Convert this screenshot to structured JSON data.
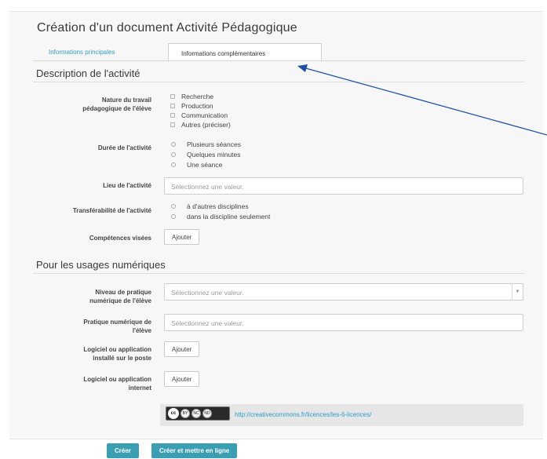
{
  "page": {
    "title": "Création d'un document Activité Pédagogique",
    "tabs": [
      {
        "label": "Informations principales",
        "active": false
      },
      {
        "label": "Informations complémentaires",
        "active": true
      }
    ]
  },
  "description": {
    "heading": "Description de l'activité",
    "nature": {
      "label_lines": [
        "Nature du travail",
        "pédagogique de l'élève"
      ],
      "options": [
        "Recherche",
        "Production",
        "Communication",
        "Autres (préciser)"
      ]
    },
    "duree": {
      "label": "Durée de l'activité",
      "options": [
        "Plusieurs séances",
        "Quelques minutes",
        "Une séance"
      ]
    },
    "lieu": {
      "label": "Lieu de l'activité",
      "placeholder": "Sélectionnez une valeur."
    },
    "transferabilite": {
      "label": "Transférabilité de l'activité",
      "options": [
        "à d'autres disciplines",
        "dans la discipline seulement"
      ]
    },
    "competences": {
      "label": "Compétences visées",
      "button": "Ajouter"
    }
  },
  "numerique": {
    "heading": "Pour les usages numériques",
    "niveau": {
      "label_lines": [
        "Niveau de pratique",
        "numérique de l'élève"
      ],
      "placeholder": "Sélectionnez une valeur."
    },
    "pratique": {
      "label_lines": [
        "Pratique numérique de",
        "l'élève"
      ],
      "placeholder": "Sélectionnez une valeur."
    },
    "logiciel_poste": {
      "label_lines": [
        "Logiciel ou application",
        "installé sur le poste"
      ],
      "button": "Ajouter"
    },
    "logiciel_internet": {
      "label_lines": [
        "Logiciel ou application",
        "internet"
      ],
      "button": "Ajouter"
    }
  },
  "license": {
    "badge": {
      "main": "cc",
      "icons": [
        "BY",
        "NC",
        "ND"
      ]
    },
    "link": "http://creativecommons.fr/licences/les-6-licences/"
  },
  "actions": {
    "create": "Créer",
    "create_publish": "Créer et mettre en ligne"
  },
  "colors": {
    "accent": "#2a9ec8",
    "button_teal": "#3a9fb3",
    "annotation_arrow": "#1f4fa8"
  }
}
